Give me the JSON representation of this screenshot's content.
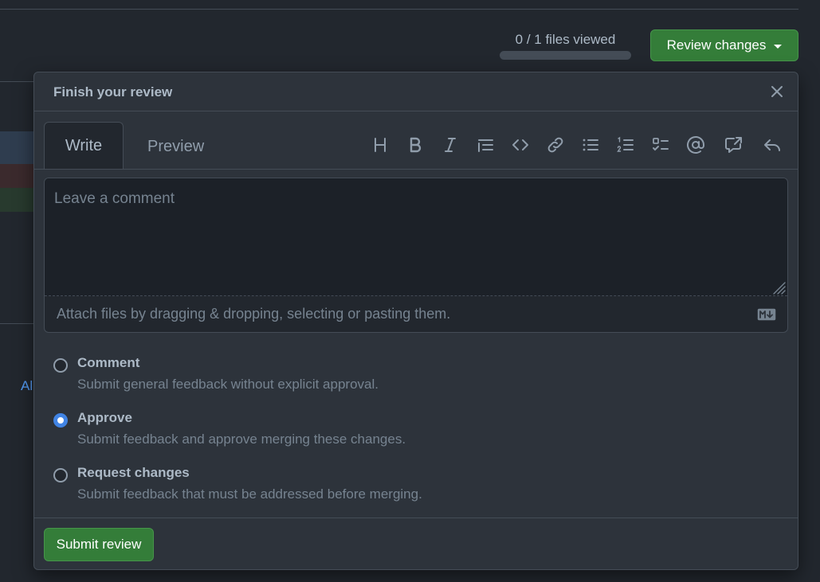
{
  "header": {
    "files_viewed": "0 / 1 files viewed",
    "files_viewed_progress": 0,
    "review_button": "Review changes"
  },
  "background": {
    "link_fragment": "Al",
    "strip_colors": [
      "#2f3d4f",
      "#3b2a2d",
      "#283a2e"
    ]
  },
  "popover": {
    "title": "Finish your review",
    "tabs": {
      "write": "Write",
      "preview": "Preview",
      "active": "write"
    },
    "toolbar_icons": [
      "heading-icon",
      "bold-icon",
      "italic-icon",
      "quote-icon",
      "code-icon",
      "link-icon",
      "bulleted-list-icon",
      "numbered-list-icon",
      "task-list-icon",
      "mention-icon",
      "reference-icon",
      "reply-icon"
    ],
    "comment": {
      "value": "",
      "placeholder": "Leave a comment",
      "attach_text": "Attach files by dragging & dropping, selecting or pasting them."
    },
    "options": [
      {
        "label": "Comment",
        "description": "Submit general feedback without explicit approval.",
        "selected": false
      },
      {
        "label": "Approve",
        "description": "Submit feedback and approve merging these changes.",
        "selected": true
      },
      {
        "label": "Request changes",
        "description": "Submit feedback that must be addressed before merging.",
        "selected": false
      }
    ],
    "submit_button": "Submit review"
  },
  "colors": {
    "background": "#22272e",
    "panel": "#2d333b",
    "border": "#444c56",
    "primary_green": "#347d39",
    "radio_selected": "#4184e4",
    "link": "#539bf5"
  }
}
